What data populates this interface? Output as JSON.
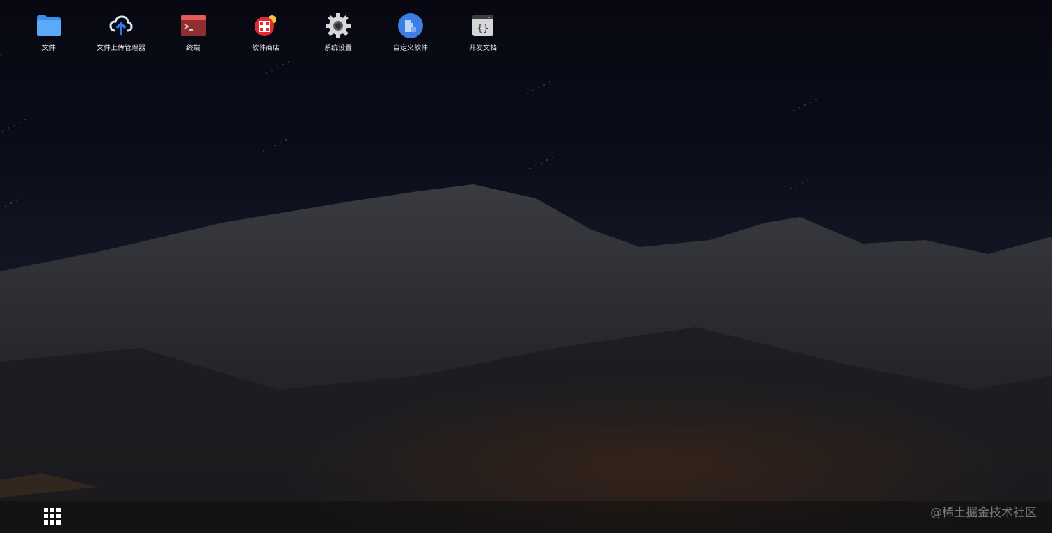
{
  "desktop": {
    "apps": [
      {
        "label": "文件",
        "icon": "folder-icon"
      },
      {
        "label": "文件上传管理器",
        "icon": "cloud-upload-icon"
      },
      {
        "label": "终端",
        "icon": "terminal-icon"
      },
      {
        "label": "软件商店",
        "icon": "app-store-icon"
      },
      {
        "label": "系统设置",
        "icon": "gear-icon"
      },
      {
        "label": "自定义软件",
        "icon": "puzzle-icon"
      },
      {
        "label": "开发文档",
        "icon": "code-doc-icon"
      }
    ]
  },
  "taskbar": {
    "launcher_icon": "grid-icon"
  },
  "watermark": "@稀土掘金技术社区"
}
